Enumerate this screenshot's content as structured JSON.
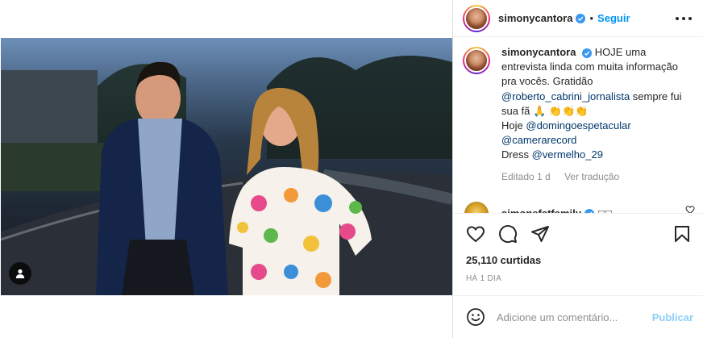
{
  "header": {
    "username": "simonycantora",
    "separator": "•",
    "follow_label": "Seguir"
  },
  "caption": {
    "username": "simonycantora",
    "line1": "HOJE uma entrevista linda com muita informação pra vocês. Gratidão",
    "mention1": "@roberto_cabrini_jornalista",
    "line2": "sempre fui sua fã",
    "emojis": "🙏 👏👏👏",
    "prefix_hoje": "Hoje",
    "mention2": "@domingoespetacular",
    "mention3": "@camerarecord",
    "prefix_dress": "Dress",
    "mention4": "@vermelho_29",
    "edited_label": "Editado",
    "age": "1 d",
    "translate_label": "Ver tradução"
  },
  "comment": {
    "username": "simonefatfamily",
    "text": "□□"
  },
  "likes": "25,110 curtidas",
  "time_ago": "HÁ 1 DIA",
  "add_comment": {
    "placeholder": "Adicione um comentário...",
    "post_label": "Publicar"
  },
  "icons": {
    "verified": "verified-badge-icon",
    "more": "more-options-icon",
    "like": "heart-icon",
    "comment": "comment-icon",
    "share": "share-icon",
    "save": "bookmark-icon",
    "emoji": "emoji-icon",
    "tag": "user-tag-icon"
  },
  "colors": {
    "accent": "#0095f6",
    "verified": "#3897f0",
    "mention": "#00376b",
    "muted": "#8e8e8e"
  }
}
